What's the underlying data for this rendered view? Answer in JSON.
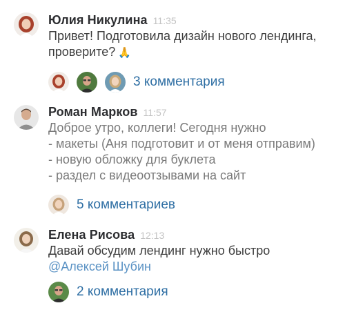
{
  "messages": [
    {
      "author": "Юлия Никулина",
      "time": "11:35",
      "lines": [
        "Привет! Подготовила дизайн нового лендинга,",
        "проверите?"
      ],
      "emoji": "🙏",
      "replies": {
        "count_label": "3 комментария",
        "avatars": [
          "avatar-woman-red",
          "avatar-man-glasses",
          "avatar-woman-blonde"
        ]
      }
    },
    {
      "author": "Роман Марков",
      "time": "11:57",
      "lines": [
        "Доброе утро, коллеги! Сегодня нужно",
        "- макеты (Аня подготовит и от меня отправим)",
        "- новую обложку для буклета",
        "- раздел с видеоотзывами на сайт"
      ],
      "replies": {
        "count_label": "5 комментариев",
        "avatars": [
          "avatar-woman-blonde"
        ]
      }
    },
    {
      "author": "Елена Рисова",
      "time": "12:13",
      "lines": [
        "Давай обсудим лендинг нужно быстро"
      ],
      "mention": "@Алексей Шубин",
      "replies": {
        "count_label": "2 комментария",
        "avatars": [
          "avatar-man-glasses"
        ]
      }
    }
  ],
  "colors": {
    "author": "#2c2d30",
    "time": "#c3c3c3",
    "body": "#3d3d3d",
    "link": "#2f6fa4",
    "mention": "#5a92c4"
  }
}
